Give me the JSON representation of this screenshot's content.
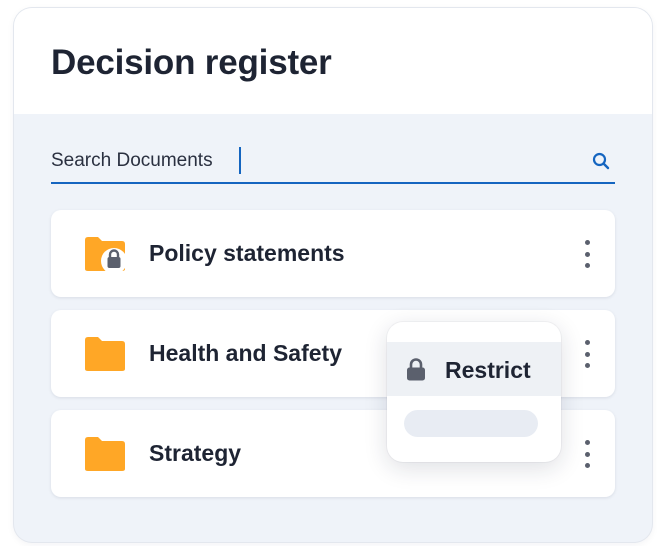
{
  "header": {
    "title": "Decision register"
  },
  "search": {
    "placeholder": "Search Documents",
    "value": "",
    "icon": "search-icon"
  },
  "folders": [
    {
      "label": "Policy statements",
      "locked": true,
      "icon": "folder-locked-icon"
    },
    {
      "label": "Health and Safety",
      "locked": false,
      "icon": "folder-icon"
    },
    {
      "label": "Strategy",
      "locked": false,
      "icon": "folder-icon"
    }
  ],
  "context_menu": {
    "items": [
      {
        "label": "Restrict",
        "icon": "lock-icon"
      }
    ]
  },
  "colors": {
    "accent": "#1565c0",
    "folder": "#ffa726",
    "background": "#eff3f9",
    "text": "#1e2433",
    "icon_gray": "#5b606d"
  }
}
